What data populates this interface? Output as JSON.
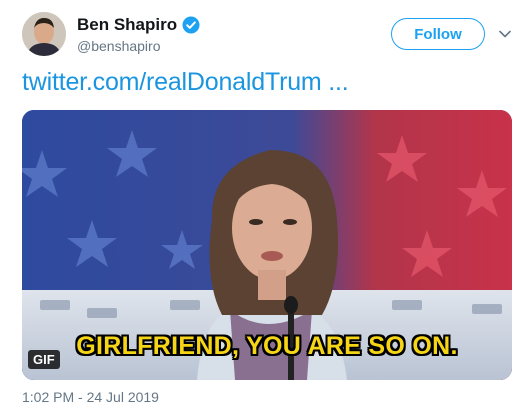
{
  "tweet": {
    "author": {
      "display_name": "Ben Shapiro",
      "handle": "@benshapiro",
      "verified": true
    },
    "follow_label": "Follow",
    "link_text": "twitter.com/realDonaldTrum ...",
    "media": {
      "type": "gif",
      "badge_label": "GIF",
      "caption": "GIRLFRIEND, YOU ARE SO ON."
    },
    "timestamp": "1:02 PM - 24 Jul 2019"
  },
  "icons": {
    "verified": "verified-badge-icon",
    "menu": "chevron-down-icon"
  },
  "colors": {
    "accent": "#1da1f2",
    "link": "#1b95e0",
    "muted": "#657786",
    "caption": "#f5d515"
  }
}
